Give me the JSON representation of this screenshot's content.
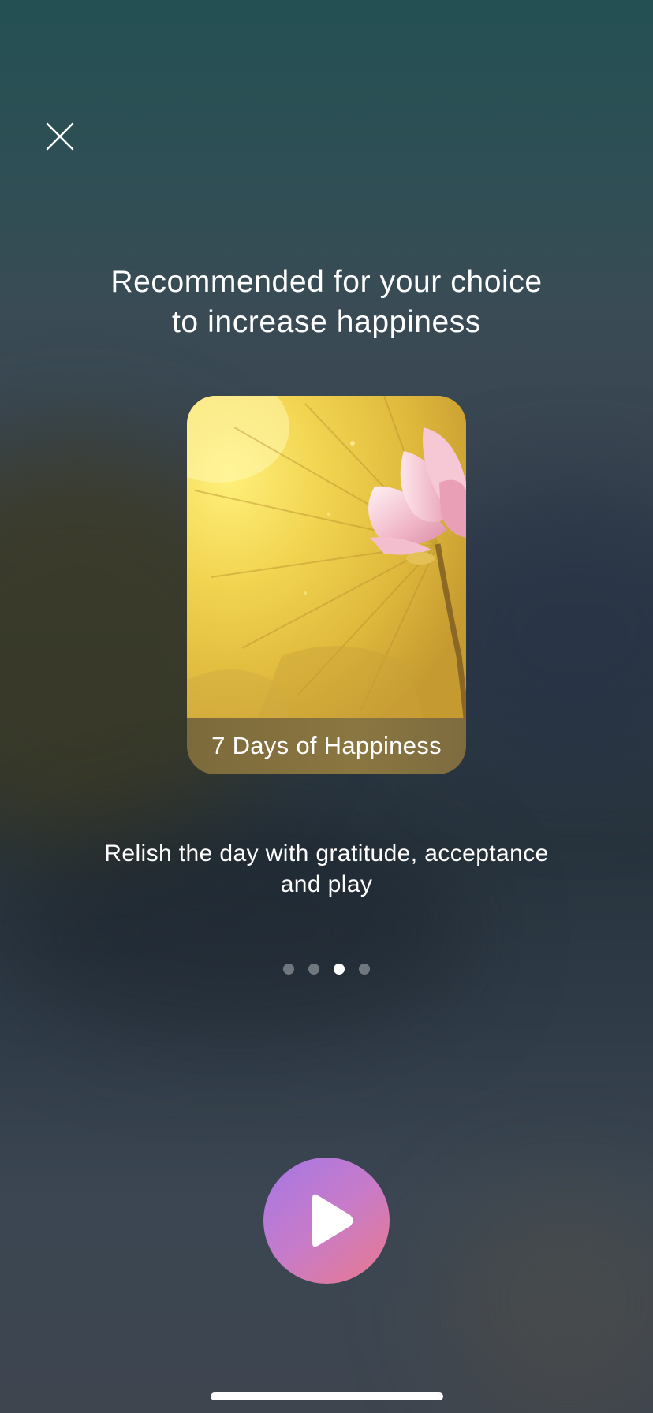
{
  "header": {
    "close_icon": "close-icon",
    "headline_line1": "Recommended for your choice",
    "headline_line2": "to increase happiness"
  },
  "card": {
    "title": "7 Days of Happiness",
    "image": "lotus-flower-image"
  },
  "description": {
    "line1": "Relish the day with gratitude, acceptance",
    "line2": "and play"
  },
  "pager": {
    "total": 4,
    "active_index": 2
  },
  "player": {
    "play_icon": "play-icon",
    "gradient": [
      "#a577e6",
      "#ea7a8c"
    ]
  },
  "colors": {
    "background_top": "#245053",
    "background_bottom": "#3e454f",
    "text": "#ffffff"
  }
}
